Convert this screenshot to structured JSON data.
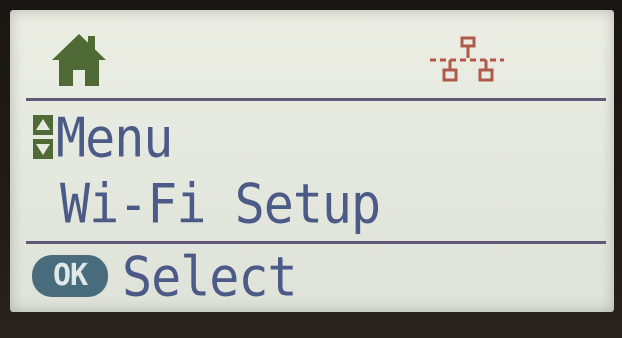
{
  "header": {
    "home_icon": "home-icon",
    "network_icon": "wired-network-icon"
  },
  "menu": {
    "scroll_icon": "scroll-up-down-icon",
    "title": "Menu",
    "current_item": "Wi-Fi Setup"
  },
  "footer": {
    "ok_button_label": "OK",
    "action_label": "Select"
  },
  "colors": {
    "lcd_background": "#e8eae0",
    "text": "#4b5a86",
    "icon_green": "#4f6a37",
    "network_red": "#b05a4a",
    "divider": "#4c3f66",
    "ok_badge": "#496c7c"
  }
}
